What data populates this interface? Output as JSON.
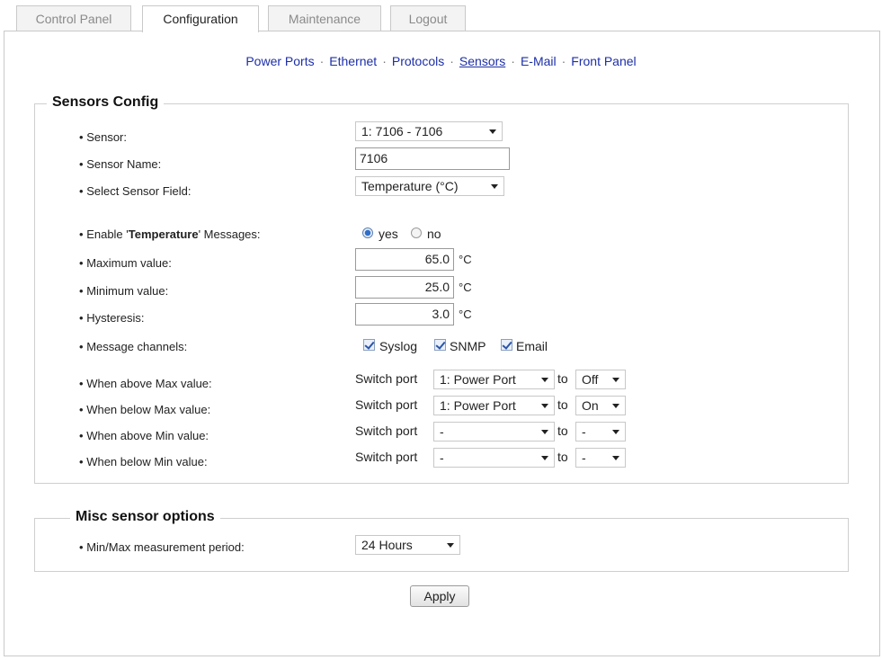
{
  "tabs": [
    "Control Panel",
    "Configuration",
    "Maintenance",
    "Logout"
  ],
  "subnav": [
    "Power Ports",
    "Ethernet",
    "Protocols",
    "Sensors",
    "E-Mail",
    "Front Panel"
  ],
  "sensors_config": {
    "legend": "Sensors Config",
    "sensor_label": "Sensor:",
    "sensor_value": "1: 7106 - 7106",
    "sensor_name_label": "Sensor Name:",
    "sensor_name_value": "7106",
    "field_label": "Select Sensor Field:",
    "field_value": "Temperature (°C)",
    "enable_prefix": "Enable '",
    "enable_field": "Temperature",
    "enable_suffix": "' Messages:",
    "yes": "yes",
    "no": "no",
    "enabled": "yes",
    "max_label": "Maximum value:",
    "max_value": "65.0",
    "min_label": "Minimum value:",
    "min_value": "25.0",
    "hyst_label": "Hysteresis:",
    "hyst_value": "3.0",
    "unit": "°C",
    "channels_label": "Message channels:",
    "channels": [
      "Syslog",
      "SNMP",
      "Email"
    ],
    "switch_text": "Switch port",
    "to_text": "to",
    "rules": [
      {
        "label": "When above Max value:",
        "port": "1: Power Port",
        "state": "Off"
      },
      {
        "label": "When below Max value:",
        "port": "1: Power Port",
        "state": "On"
      },
      {
        "label": "When above Min value:",
        "port": "-",
        "state": "-"
      },
      {
        "label": "When below Min value:",
        "port": "-",
        "state": "-"
      }
    ]
  },
  "misc": {
    "legend": "Misc sensor options",
    "period_label": "Min/Max measurement period:",
    "period_value": "24 Hours"
  },
  "apply_label": "Apply",
  "bullet": "•"
}
